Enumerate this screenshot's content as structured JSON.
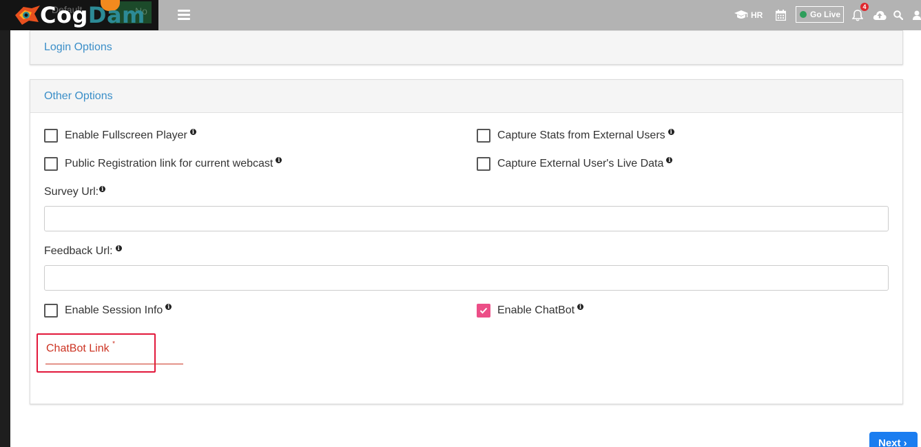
{
  "header": {
    "logo": {
      "part1": "Cog",
      "part2": "Dam",
      "ghost_left": "Default",
      "ghost_right": "No"
    },
    "hr_label": "HR",
    "golive_label": "Go Live",
    "notification_count": "4",
    "icons": [
      "hamburger-menu-icon",
      "graduation-cap-icon",
      "calendar-icon",
      "bell-icon",
      "cloud-upload-icon",
      "search-icon",
      "user-icon"
    ],
    "colors": {
      "topbar": "#b3b3b3",
      "logo_bg": "#141414",
      "logo_accent": "#2c8a96",
      "golive_dot": "#2e9e5b",
      "badge": "#e0282e"
    }
  },
  "login_options": {
    "title": "Login Options"
  },
  "other_options": {
    "title": "Other Options",
    "checkboxes": {
      "fullscreen": {
        "label": "Enable Fullscreen Player",
        "checked": false
      },
      "capture_stats": {
        "label": "Capture Stats from External Users",
        "checked": false
      },
      "public_registration": {
        "label": "Public Registration link for current webcast",
        "checked": false
      },
      "capture_live": {
        "label": "Capture External User's Live Data",
        "checked": false
      },
      "session_info": {
        "label": "Enable Session Info",
        "checked": false
      },
      "chatbot": {
        "label": "Enable ChatBot",
        "checked": true
      }
    },
    "survey_url": {
      "label": "Survey Url:",
      "value": ""
    },
    "feedback_url": {
      "label": "Feedback Url:",
      "value": ""
    },
    "chatbot_link": {
      "label": "ChatBot Link",
      "required_mark": "*",
      "value": ""
    },
    "colors": {
      "checkbox_checked": "#ec4e87",
      "link_text": "#3a8ec8",
      "required_error": "#cc3322",
      "highlight_box": "#e2173a"
    }
  },
  "footer": {
    "next_label": "Next ›",
    "next_color": "#1a7df0"
  }
}
